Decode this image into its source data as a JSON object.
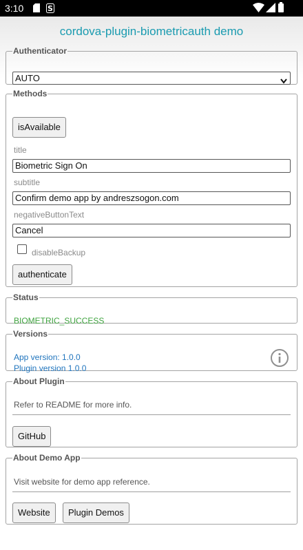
{
  "statusbar": {
    "time": "3:10",
    "icons": [
      "sd-card-icon",
      "notification-s-icon",
      "wifi-icon",
      "signal-icon",
      "battery-icon"
    ]
  },
  "page": {
    "title": "cordova-plugin-biometricauth demo"
  },
  "authenticator": {
    "legend": "Authenticator",
    "selected": "AUTO"
  },
  "methods": {
    "legend": "Methods",
    "is_available_label": "isAvailable",
    "title_label": "title",
    "title_value": "Biometric Sign On",
    "subtitle_label": "subtitle",
    "subtitle_value": "Confirm demo app by andreszsogon.com",
    "negative_label": "negativeButtonText",
    "negative_value": "Cancel",
    "disable_backup_label": "disableBackup",
    "disable_backup_checked": false,
    "authenticate_label": "authenticate"
  },
  "status": {
    "legend": "Status",
    "value": "BIOMETRIC_SUCCESS"
  },
  "versions": {
    "legend": "Versions",
    "app_version": "App version: 1.0.0",
    "plugin_version": "Plugin version 1.0.0",
    "info_icon": "info-icon"
  },
  "about_plugin": {
    "legend": "About Plugin",
    "text": "Refer to README for more info.",
    "github_label": "GitHub"
  },
  "about_demo": {
    "legend": "About Demo App",
    "text": "Visit website for demo app reference.",
    "website_label": "Website",
    "plugin_demos_label": "Plugin Demos"
  },
  "colors": {
    "title": "#1a9bb0",
    "link": "#1f74bd",
    "success": "#3fa33f",
    "statusbar": "#000000"
  }
}
